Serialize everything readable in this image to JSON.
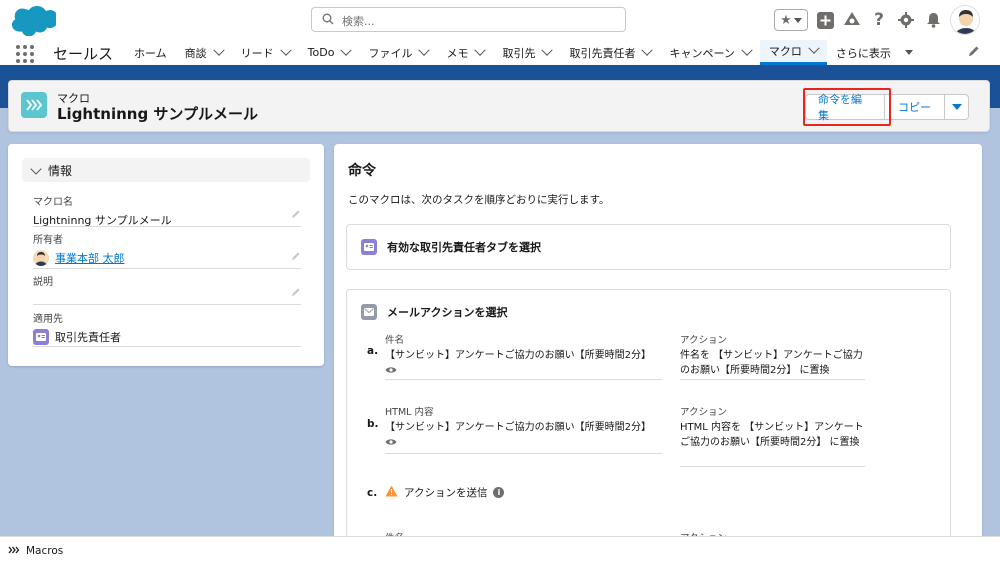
{
  "search": {
    "placeholder": "検索..."
  },
  "app": {
    "name": "セールス"
  },
  "nav": {
    "items": [
      {
        "label": "ホーム",
        "chevron": false
      },
      {
        "label": "商談",
        "chevron": true
      },
      {
        "label": "リード",
        "chevron": true
      },
      {
        "label": "ToDo",
        "chevron": true
      },
      {
        "label": "ファイル",
        "chevron": true
      },
      {
        "label": "メモ",
        "chevron": true
      },
      {
        "label": "取引先",
        "chevron": true
      },
      {
        "label": "取引先責任者",
        "chevron": true
      },
      {
        "label": "キャンペーン",
        "chevron": true
      },
      {
        "label": "マクロ",
        "chevron": true,
        "active": true
      },
      {
        "label": "さらに表示",
        "chevron": false,
        "more": true
      }
    ]
  },
  "record": {
    "object_label": "マクロ",
    "title": "Lightninng サンプルメール",
    "buttons": {
      "edit_instructions": "命令を編集",
      "copy": "コピー"
    }
  },
  "info": {
    "section_title": "情報",
    "fields": {
      "macro_name_label": "マクロ名",
      "macro_name_value": "Lightninng サンプルメール",
      "owner_label": "所有者",
      "owner_value": "事業本部 太郎",
      "description_label": "説明",
      "description_value": "",
      "applies_to_label": "適用先",
      "applies_to_value": "取引先責任者"
    }
  },
  "instructions": {
    "title": "命令",
    "description": "このマクロは、次のタスクを順序どおりに実行します。",
    "step1": "有効な取引先責任者タブを選択",
    "step2": {
      "title": "メールアクションを選択",
      "a": {
        "letter": "a.",
        "field_label": "件名",
        "field_value": "【サンビット】アンケートご協力のお願い【所要時間2分】",
        "action_label": "アクション",
        "action_value": "件名を 【サンビット】アンケートご協力のお願い【所要時間2分】 に置換"
      },
      "b": {
        "letter": "b.",
        "field_label": "HTML 内容",
        "field_value": "【サンビット】アンケートご協力のお願い【所要時間2分】",
        "action_label": "アクション",
        "action_value": "HTML 内容を 【サンビット】アンケートご協力のお願い【所要時間2分】 に置換"
      },
      "c": {
        "letter": "c.",
        "label": "アクションを送信"
      },
      "next_field_label": "件名",
      "next_action_label": "アクション"
    }
  },
  "utility": {
    "label": "Macros"
  },
  "colors": {
    "brand": "#0176d3",
    "band": "#1b5297",
    "highlight": "#e8251f"
  }
}
